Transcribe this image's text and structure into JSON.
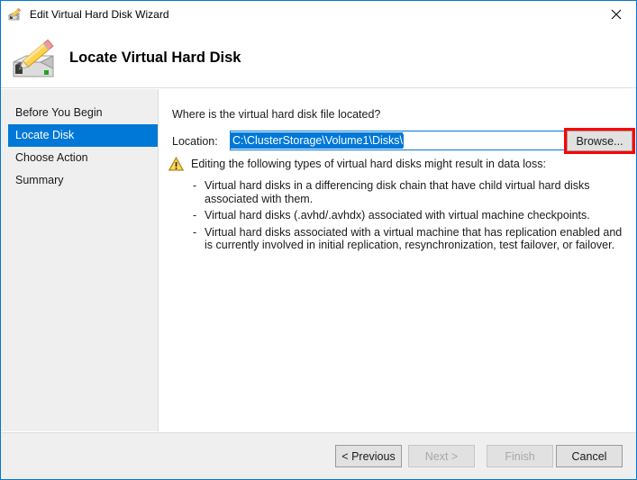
{
  "window": {
    "title": "Edit Virtual Hard Disk Wizard",
    "title_icon": "edit-virtual-hard-disk-icon",
    "close_icon": "close-icon"
  },
  "header": {
    "title": "Locate Virtual Hard Disk",
    "icon": "hard-disk-with-pencil-icon"
  },
  "sidebar": {
    "items": [
      {
        "label": "Before You Begin",
        "selected": false
      },
      {
        "label": "Locate Disk",
        "selected": true
      },
      {
        "label": "Choose Action",
        "selected": false
      },
      {
        "label": "Summary",
        "selected": false
      }
    ]
  },
  "main": {
    "question": "Where is the virtual hard disk file located?",
    "location": {
      "label": "Location:",
      "value": "C:\\ClusterStorage\\Volume1\\Disks\\",
      "placeholder": "",
      "selected": true
    },
    "browse_button": {
      "label": "Browse...",
      "highlight_color": "#ff0000"
    },
    "warning": {
      "icon": "warning-triangle-icon",
      "heading": "Editing the following types of virtual hard disks might result in data loss:",
      "bullet_marker": "-",
      "items": [
        "Virtual hard disks in a differencing disk chain that have child virtual hard disks associated with them.",
        "Virtual hard disks (.avhd/.avhdx) associated with virtual machine checkpoints.",
        "Virtual hard disks associated with a virtual machine that has replication enabled and is currently involved in initial replication, resynchronization, test failover, or failover."
      ]
    }
  },
  "footer": {
    "buttons": [
      {
        "label": "< Previous",
        "disabled": false
      },
      {
        "label": "Next >",
        "disabled": true
      },
      {
        "label": "Finish",
        "disabled": true
      },
      {
        "label": "Cancel",
        "disabled": false
      }
    ]
  },
  "colors": {
    "accent": "#0078d7",
    "selection": "#0078d7",
    "chrome": "#efefef",
    "button_face": "#e1e1e1",
    "highlight": "#ff0000"
  }
}
